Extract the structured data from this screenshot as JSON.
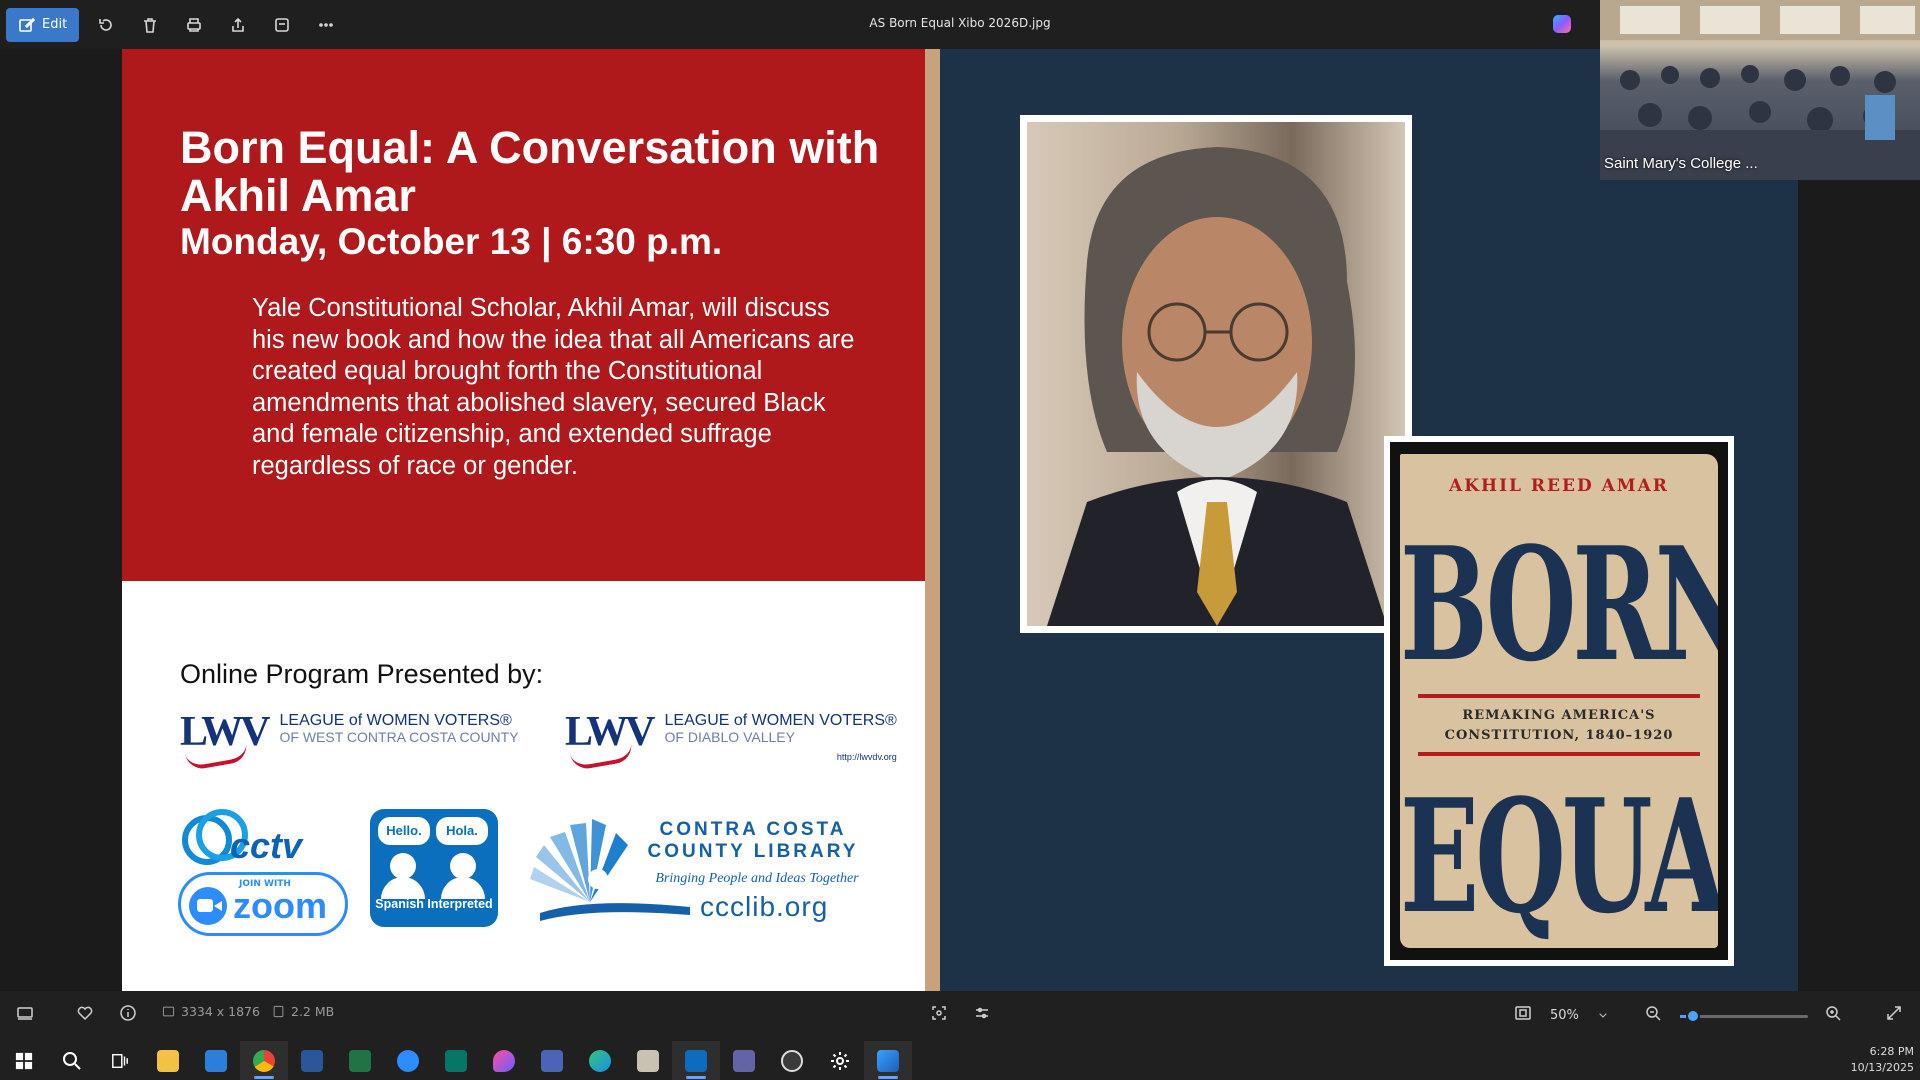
{
  "toolbar": {
    "edit_label": "Edit",
    "filename": "AS Born Equal Xibo 2026D.jpg"
  },
  "flyer": {
    "title": "Born Equal: A Conversation with Akhil Amar",
    "datetime": "Monday, October 13 | 6:30 p.m.",
    "description": "Yale Constitutional Scholar, Akhil Amar, will discuss his new book and how the idea that all Americans are created equal brought forth the Constitutional amendments that abolished slavery, secured Black and female citizenship, and extended suffrage regardless of race or gender.",
    "presented_by": "Online Program Presented by:",
    "lwv_letters": "LWV",
    "lwv1_line1": "LEAGUE of WOMEN VOTERS®",
    "lwv1_line2": "OF WEST CONTRA COSTA COUNTY",
    "lwv2_line1": "LEAGUE of WOMEN VOTERS®",
    "lwv2_line2": "OF DIABLO VALLEY",
    "lwv2_url": "http://lwvdv.org",
    "cctv": "cctv",
    "zoom_join": "JOIN WITH",
    "zoom_word": "zoom",
    "spanish_hello": "Hello.",
    "spanish_hola": "Hola.",
    "spanish_label": "Spanish Interpreted",
    "library_name_1": "CONTRA COSTA",
    "library_name_2": "COUNTY LIBRARY",
    "library_tagline": "Bringing People and Ideas Together",
    "library_web": "ccclib.org",
    "book_author": "AKHIL REED AMAR",
    "book_word1": "BORN",
    "book_subtitle_1": "REMAKING AMERICA'S",
    "book_subtitle_2": "CONSTITUTION, 1840–1920",
    "book_word2": "EQUAL"
  },
  "video_thumb": {
    "label": "Saint Mary's College ..."
  },
  "statusbar": {
    "dimensions": "3334 x 1876",
    "filesize": "2.2 MB",
    "zoom_value": "50%",
    "zoom_level": 0.05
  },
  "taskbar": {
    "time": "6:28 PM",
    "date": "10/13/2025"
  }
}
